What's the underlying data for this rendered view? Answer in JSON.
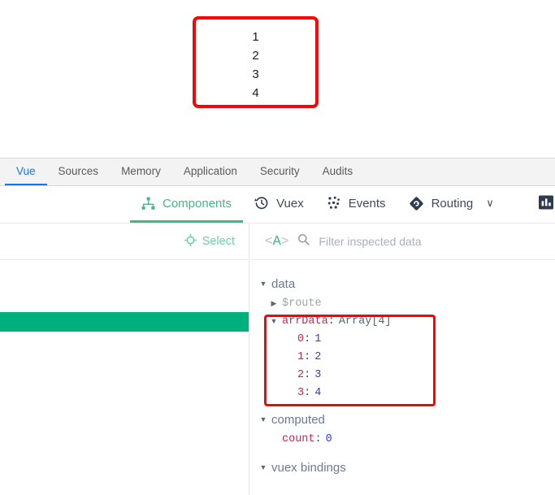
{
  "preview": {
    "list_items": [
      "1",
      "2",
      "3",
      "4"
    ],
    "callout_color": "#fb0007"
  },
  "chrome_tabs": [
    {
      "label": "Vue",
      "active": true
    },
    {
      "label": "Sources",
      "active": false
    },
    {
      "label": "Memory",
      "active": false
    },
    {
      "label": "Application",
      "active": false
    },
    {
      "label": "Security",
      "active": false
    },
    {
      "label": "Audits",
      "active": false
    }
  ],
  "vue_nav": {
    "items": [
      {
        "label": "Components",
        "icon": "components-tree-icon",
        "active": true
      },
      {
        "label": "Vuex",
        "icon": "history-clock-icon",
        "active": false
      },
      {
        "label": "Events",
        "icon": "events-dots-icon",
        "active": false
      },
      {
        "label": "Routing",
        "icon": "routing-diamond-icon",
        "active": false,
        "chevron": "∨"
      }
    ],
    "right_icon": "bar-chart-icon",
    "active_color": "#42b983"
  },
  "left_panel": {
    "select_label": "Select",
    "select_icon": "crosshair-target-icon",
    "selected_row_color": "#00b07c"
  },
  "inspector": {
    "tag_icon_left": "<",
    "tag_icon_letter": "A",
    "tag_icon_right": ">",
    "search_icon": "search-icon",
    "filter_placeholder": "Filter inspected data",
    "filter_value": ""
  },
  "data_tree": {
    "groups": [
      {
        "name": "data",
        "expanded": true,
        "rows": [
          {
            "key": "$route",
            "kind": "collapsed-object",
            "value": "",
            "depth": 1
          },
          {
            "key": "arrData",
            "kind": "expanded-object",
            "value": "Array[4]",
            "depth": 1
          },
          {
            "key": "0",
            "kind": "leaf-number",
            "value": "1",
            "depth": 2
          },
          {
            "key": "1",
            "kind": "leaf-number",
            "value": "2",
            "depth": 2
          },
          {
            "key": "2",
            "kind": "leaf-number",
            "value": "3",
            "depth": 2
          },
          {
            "key": "3",
            "kind": "leaf-number",
            "value": "4",
            "depth": 2
          }
        ]
      },
      {
        "name": "computed",
        "expanded": true,
        "rows": [
          {
            "key": "count",
            "kind": "leaf-number",
            "value": "0",
            "depth": 1
          }
        ]
      },
      {
        "name": "vuex bindings",
        "expanded": true,
        "rows": []
      }
    ],
    "callout_color": "#fb0007"
  },
  "glyphs": {
    "triangle_down": "▼",
    "triangle_right": "▶"
  }
}
